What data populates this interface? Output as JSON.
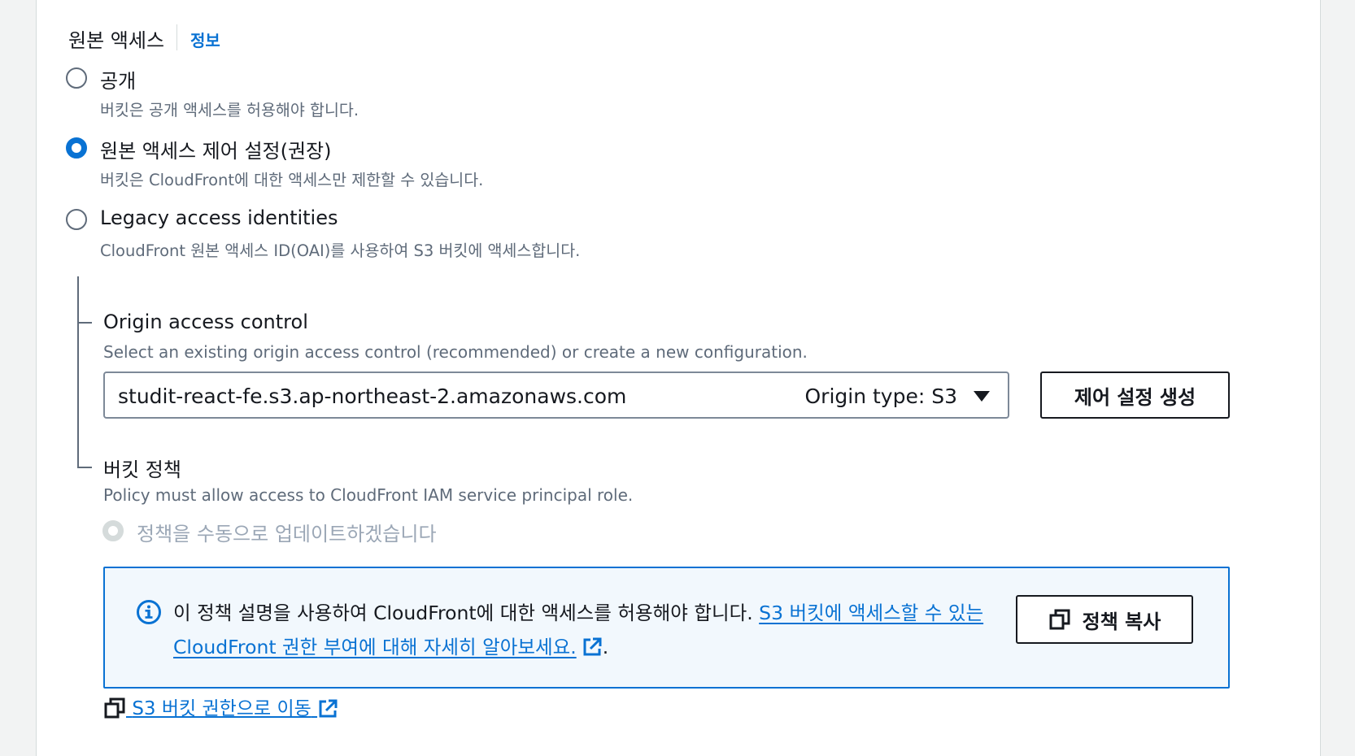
{
  "section": {
    "title": "원본 액세스",
    "info_link": "정보"
  },
  "origin_access_options": [
    {
      "label": "공개",
      "description": "버킷은 공개 액세스를 허용해야 합니다.",
      "selected": false
    },
    {
      "label": "원본 액세스 제어 설정(권장)",
      "description": "버킷은 CloudFront에 대한 액세스만 제한할 수 있습니다.",
      "selected": true
    },
    {
      "label": "Legacy access identities",
      "description": "CloudFront 원본 액세스 ID(OAI)를 사용하여 S3 버킷에 액세스합니다.",
      "selected": false
    }
  ],
  "origin_access_control": {
    "label": "Origin access control",
    "description": "Select an existing origin access control (recommended) or create a new configuration.",
    "selected_value": "studit-react-fe.s3.ap-northeast-2.amazonaws.com",
    "origin_type": "Origin type: S3",
    "create_button": "제어 설정 생성"
  },
  "bucket_policy": {
    "label": "버킷 정책",
    "description": "Policy must allow access to CloudFront IAM service principal role.",
    "option_label": "정책을 수동으로 업데이트하겠습니다"
  },
  "alert": {
    "text": "이 정책 설명을 사용하여 CloudFront에 대한 액세스를 허용해야 합니다. ",
    "link_text": "S3 버킷에 액세스할 수 있는 CloudFront 권한 부여에 대해 자세히 알아보세요.",
    "trailing": ".",
    "copy_button": "정책 복사"
  },
  "bottom_link": "S3 버킷 권한으로 이동",
  "colors": {
    "accent": "#0972d3",
    "alert_bg": "#f2f8fd",
    "disabled": "#9ba7b6"
  }
}
